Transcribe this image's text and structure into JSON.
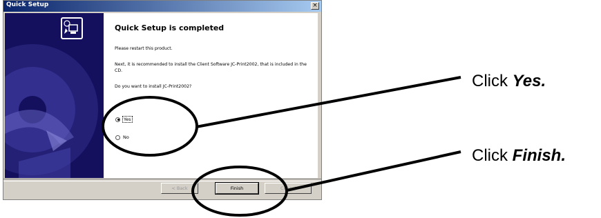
{
  "window": {
    "title": "Quick Setup",
    "close_glyph": "×"
  },
  "content": {
    "heading": "Quick Setup is completed",
    "line1": "Please restart this product.",
    "line2": "Next, it is recommended to install the Client Software JC-Print2002, that is included in the CD.",
    "question": "Do you want to install JC-Print2002?"
  },
  "options": {
    "yes": {
      "label": "Yes",
      "checked": true
    },
    "no": {
      "label": "No",
      "checked": false
    }
  },
  "buttons": {
    "back": "< Back",
    "finish": "Finish",
    "cancel": "Cancel"
  },
  "annotations": {
    "yes_prefix": "Click ",
    "yes_emph": "Yes.",
    "finish_prefix": "Click ",
    "finish_emph": "Finish."
  },
  "icons": [
    "close-icon",
    "setup-computer-icon",
    "cd-disc-illustration"
  ],
  "colors": {
    "side_panel": "#14105e",
    "title_gradient_start": "#0a246a",
    "dialog_face": "#d4d0c8"
  }
}
